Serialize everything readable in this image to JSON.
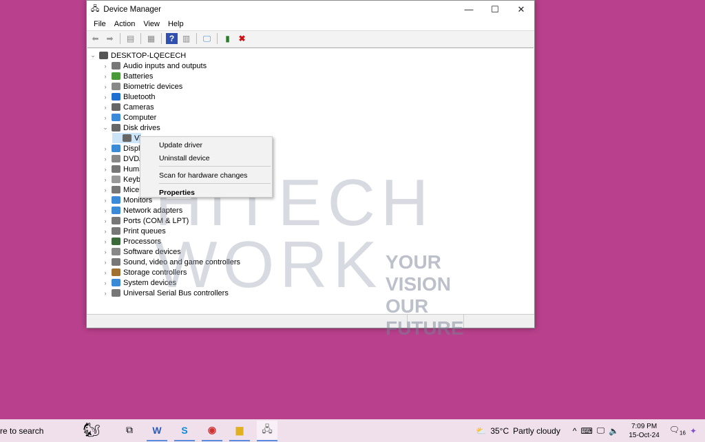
{
  "window": {
    "title": "Device Manager",
    "minimize": "—",
    "maximize": "☐",
    "close": "✕"
  },
  "menu": [
    "File",
    "Action",
    "View",
    "Help"
  ],
  "tree": {
    "root": "DESKTOP-LQECECH",
    "items": [
      {
        "label": "Audio inputs and outputs",
        "color": "#777"
      },
      {
        "label": "Batteries",
        "color": "#4a9a3a"
      },
      {
        "label": "Biometric devices",
        "color": "#888"
      },
      {
        "label": "Bluetooth",
        "color": "#1e6fd0"
      },
      {
        "label": "Cameras",
        "color": "#666"
      },
      {
        "label": "Computer",
        "color": "#3a8ad8"
      },
      {
        "label": "Disk drives",
        "color": "#666",
        "expanded": true,
        "children": [
          "Vi"
        ]
      },
      {
        "label": "Display adapters",
        "color": "#3a8ad8"
      },
      {
        "label": "DVD/CD-ROM drives",
        "color": "#888"
      },
      {
        "label": "Human Interface Devices",
        "color": "#777"
      },
      {
        "label": "Keyboards",
        "color": "#999"
      },
      {
        "label": "Mice and other pointing devices",
        "color": "#777"
      },
      {
        "label": "Monitors",
        "color": "#3a8ad8"
      },
      {
        "label": "Network adapters",
        "color": "#3a8ad8"
      },
      {
        "label": "Ports (COM & LPT)",
        "color": "#777"
      },
      {
        "label": "Print queues",
        "color": "#777"
      },
      {
        "label": "Processors",
        "color": "#3a6a3a"
      },
      {
        "label": "Software devices",
        "color": "#888"
      },
      {
        "label": "Sound, video and game controllers",
        "color": "#777"
      },
      {
        "label": "Storage controllers",
        "color": "#a07030"
      },
      {
        "label": "System devices",
        "color": "#3a8ad8"
      },
      {
        "label": "Universal Serial Bus controllers",
        "color": "#777"
      }
    ]
  },
  "context_menu": {
    "update": "Update driver",
    "uninstall": "Uninstall device",
    "scan": "Scan for hardware changes",
    "properties": "Properties"
  },
  "watermark": {
    "line1": "HITECH",
    "line2": "WORK",
    "tag1": "YOUR VISION",
    "tag2": "OUR FUTURE"
  },
  "taskbar": {
    "search": "re to search",
    "weather": "35°C",
    "weather_desc": "Partly cloudy",
    "time": "7:09 PM",
    "date": "15-Oct-24",
    "notifications": "16"
  }
}
